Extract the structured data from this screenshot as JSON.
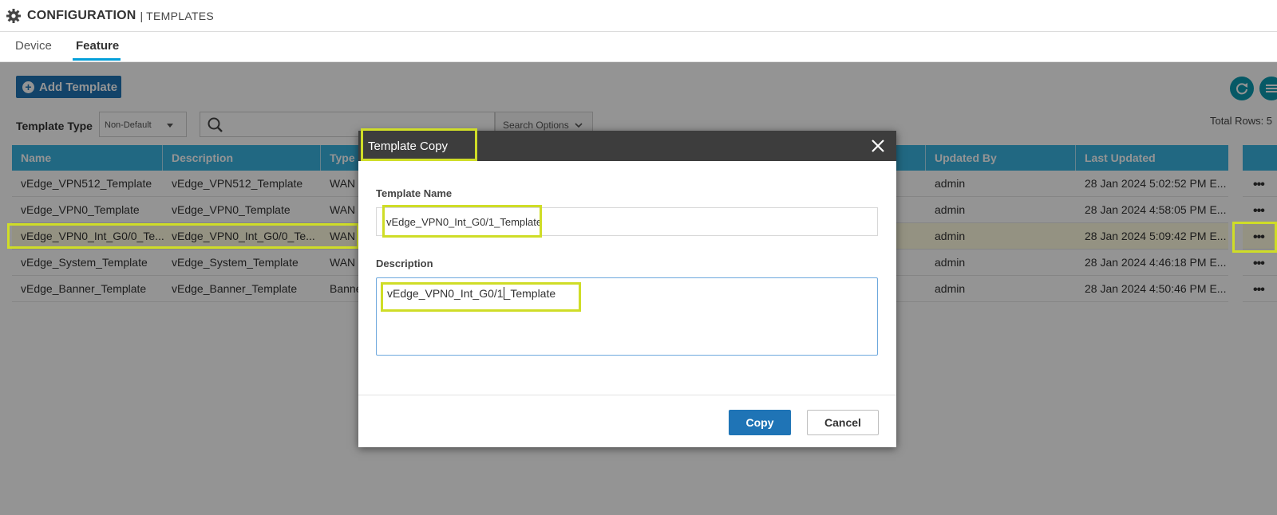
{
  "header": {
    "section": "CONFIGURATION",
    "separator": "|",
    "subsection": "TEMPLATES",
    "icon": "gear-icon"
  },
  "tabs": [
    {
      "label": "Device",
      "active": false
    },
    {
      "label": "Feature",
      "active": true
    }
  ],
  "toolbar": {
    "add_label": "Add Template",
    "template_type_label": "Template Type",
    "template_type_value": "Non-Default",
    "search_value": "",
    "search_options_label": "Search Options",
    "total_rows": "Total Rows: 5"
  },
  "table": {
    "columns": [
      "Name",
      "Description",
      "Type",
      "Updated By",
      "Last Updated"
    ],
    "rows": [
      {
        "name": "vEdge_VPN512_Template",
        "description": "vEdge_VPN512_Template",
        "type": "WAN",
        "updated_by": "admin",
        "last_updated": "28 Jan 2024 5:02:52 PM E...",
        "selected": false
      },
      {
        "name": "vEdge_VPN0_Template",
        "description": "vEdge_VPN0_Template",
        "type": "WAN",
        "updated_by": "admin",
        "last_updated": "28 Jan 2024 4:58:05 PM E...",
        "selected": false
      },
      {
        "name": "vEdge_VPN0_Int_G0/0_Te...",
        "description": "vEdge_VPN0_Int_G0/0_Te...",
        "type": "WAN",
        "updated_by": "admin",
        "last_updated": "28 Jan 2024 5:09:42 PM E...",
        "selected": true
      },
      {
        "name": "vEdge_System_Template",
        "description": "vEdge_System_Template",
        "type": "WAN",
        "updated_by": "admin",
        "last_updated": "28 Jan 2024 4:46:18 PM E...",
        "selected": false
      },
      {
        "name": "vEdge_Banner_Template",
        "description": "vEdge_Banner_Template",
        "type": "Banne",
        "updated_by": "admin",
        "last_updated": "28 Jan 2024 4:50:46 PM E...",
        "selected": false
      }
    ],
    "row_action": "•••"
  },
  "modal": {
    "title": "Template Copy",
    "name_label": "Template Name",
    "name_value": "vEdge_VPN0_Int_G0/1_Template",
    "description_label": "Description",
    "description_before_cursor": "vEdge_VPN0_Int_G0/1",
    "description_after_cursor": "_Template",
    "copy_label": "Copy",
    "cancel_label": "Cancel"
  },
  "colors": {
    "accent": "#1f74b6",
    "table_header": "#3ab3e0",
    "highlight_box": "#cfdd27",
    "modal_header": "#3d3d3d"
  }
}
